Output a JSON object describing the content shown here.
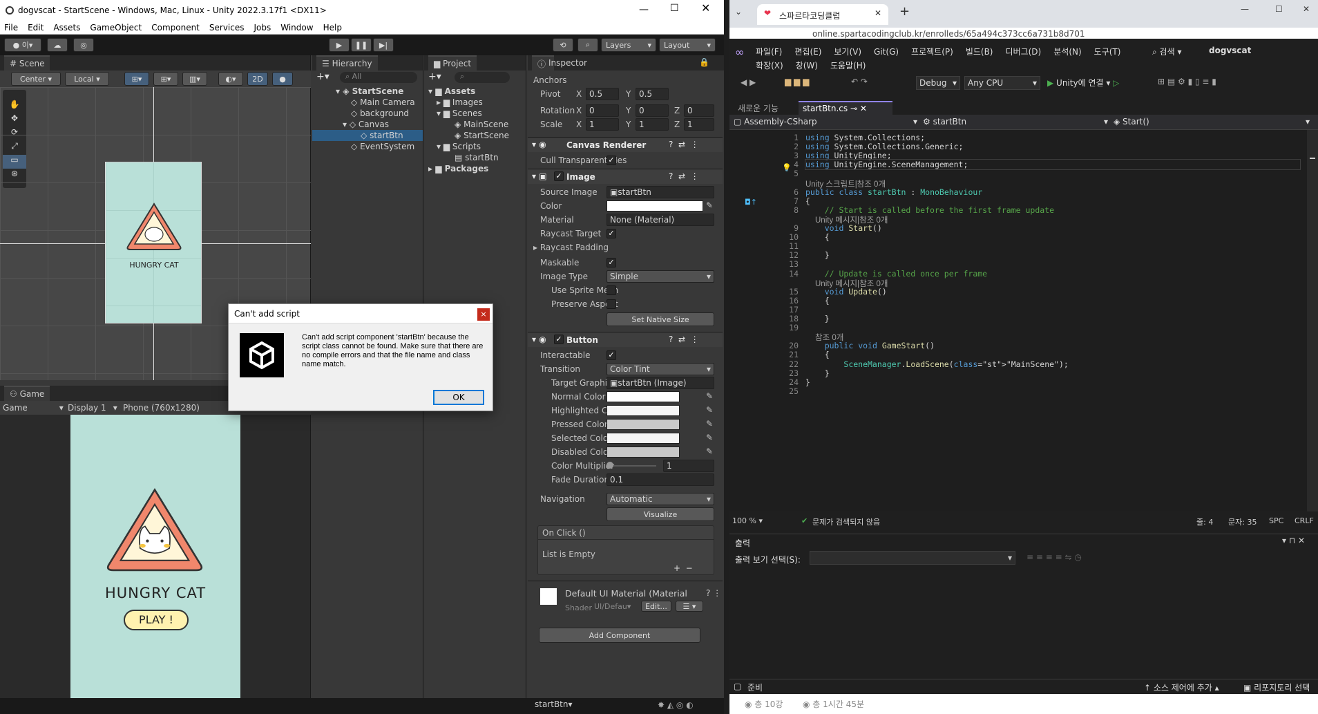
{
  "unity": {
    "title": "dogvscat - StartScene - Windows, Mac, Linux - Unity 2022.3.17f1 <DX11>",
    "menu": [
      "File",
      "Edit",
      "Assets",
      "GameObject",
      "Component",
      "Services",
      "Jobs",
      "Window",
      "Help"
    ],
    "account": "이",
    "layers": "Layers",
    "layout": "Layout",
    "scene_tab": "Scene",
    "pivot": "Center",
    "space": "Local",
    "mode2d": "2D",
    "hierarchy_tab": "Hierarchy",
    "hier_search": "All",
    "hierarchy": [
      "StartScene",
      "Main Camera",
      "background",
      "Canvas",
      "startBtn",
      "EventSystem"
    ],
    "project_tab": "Project",
    "project": [
      "Assets",
      "Images",
      "Scenes",
      "MainScene",
      "StartScene",
      "Scripts",
      "startBtn",
      "Packages"
    ],
    "inspector_tab": "Inspector",
    "game_tab": "Game",
    "game_sel": "Game",
    "display": "Display 1",
    "resolution": "Phone (760x1280)",
    "hungry": "HUNGRY CAT",
    "play": "PLAY !",
    "insp": {
      "anchors": "Anchors",
      "pivot": "Pivot",
      "px": "0.5",
      "py": "0.5",
      "rotation": "Rotation",
      "rx": "0",
      "ry": "0",
      "rz": "0",
      "scale": "Scale",
      "sx": "1",
      "sy": "1",
      "sz": "1",
      "cr": "Canvas Renderer",
      "cull": "Cull Transparent Mes",
      "image": "Image",
      "source": "Source Image",
      "source_val": "startBtn",
      "color": "Color",
      "material": "Material",
      "material_val": "None (Material)",
      "raycast": "Raycast Target",
      "padding": "Raycast Padding",
      "maskable": "Maskable",
      "imgtype": "Image Type",
      "imgtype_val": "Simple",
      "usesprite": "Use Sprite Mesh",
      "preserve": "Preserve Aspect",
      "native": "Set Native Size",
      "button": "Button",
      "interactable": "Interactable",
      "transition": "Transition",
      "transition_val": "Color Tint",
      "target": "Target Graphic",
      "target_val": "startBtn (Image)",
      "normal": "Normal Color",
      "highlighted": "Highlighted Color",
      "pressed": "Pressed Color",
      "selected": "Selected Color",
      "disabled": "Disabled Color",
      "multiplier": "Color Multiplier",
      "multiplier_val": "1",
      "fade": "Fade Duration",
      "fade_val": "0.1",
      "navigation": "Navigation",
      "navigation_val": "Automatic",
      "visualize": "Visualize",
      "onclick": "On Click ()",
      "empty": "List is Empty",
      "mat_name": "Default UI Material (Material",
      "shader": "Shader",
      "shader_val": "UI/Defau",
      "edit": "Edit...",
      "add": "Add Component",
      "x": "X",
      "y": "Y",
      "z": "Z"
    },
    "status_obj": "startBtn",
    "dialog": {
      "title": "Can't add script",
      "message": "Can't add script component 'startBtn' because the script class cannot be found. Make sure that there are no compile errors and that the file name and class name match.",
      "ok": "OK"
    }
  },
  "vs": {
    "chrome_tab": "스파르타코딩클럽",
    "url": "online.spartacodingclub.kr/enrolleds/65a494c373cc6a731b8d701",
    "menu1": [
      "파일(F)",
      "편집(E)",
      "보기(V)",
      "Git(G)",
      "프로젝트(P)",
      "빌드(B)",
      "디버그(D)",
      "분석(N)",
      "도구(T)"
    ],
    "menu2": [
      "확장(X)",
      "창(W)",
      "도움말(H)"
    ],
    "search": "검색",
    "project": "dogvscat",
    "config": "Debug",
    "platform": "Any CPU",
    "run": "Unity에 연결",
    "tab_new": "새로운 기능",
    "tab_file": "startBtn.cs",
    "nav1": "Assembly-CSharp",
    "nav2": "startBtn",
    "nav3": "Start()",
    "lines": [
      "using System.Collections;",
      "using System.Collections.Generic;",
      "using UnityEngine;",
      "using UnityEngine.SceneManagement;",
      "",
      "public class startBtn : MonoBehaviour",
      "{",
      "    // Start is called before the first frame update",
      "    void Start()",
      "    {",
      "",
      "    }",
      "",
      "    // Update is called once per frame",
      "    void Update()",
      "    {",
      "",
      "    }",
      "",
      "    public void GameStart()",
      "    {",
      "        SceneManager.LoadScene(\"MainScene\");",
      "    }",
      "}",
      ""
    ],
    "hints": [
      "Unity 스크립트|참조 0개",
      "Unity 메시지|참조 0개",
      "Unity 메시지|참조 0개",
      "참조 0개"
    ],
    "zoom": "100 %",
    "issues": "문제가 검색되지 않음",
    "row": "줄: 4",
    "col": "문자: 35",
    "spc": "SPC",
    "crlf": "CRLF",
    "output": "출력",
    "output_sel": "출력 보기 선택(S):",
    "ready": "준비",
    "scm": "소스 제어에 추가",
    "repo": "리포지토리 선택",
    "b1": "총 10강",
    "b2": "총 1시간 45분"
  }
}
